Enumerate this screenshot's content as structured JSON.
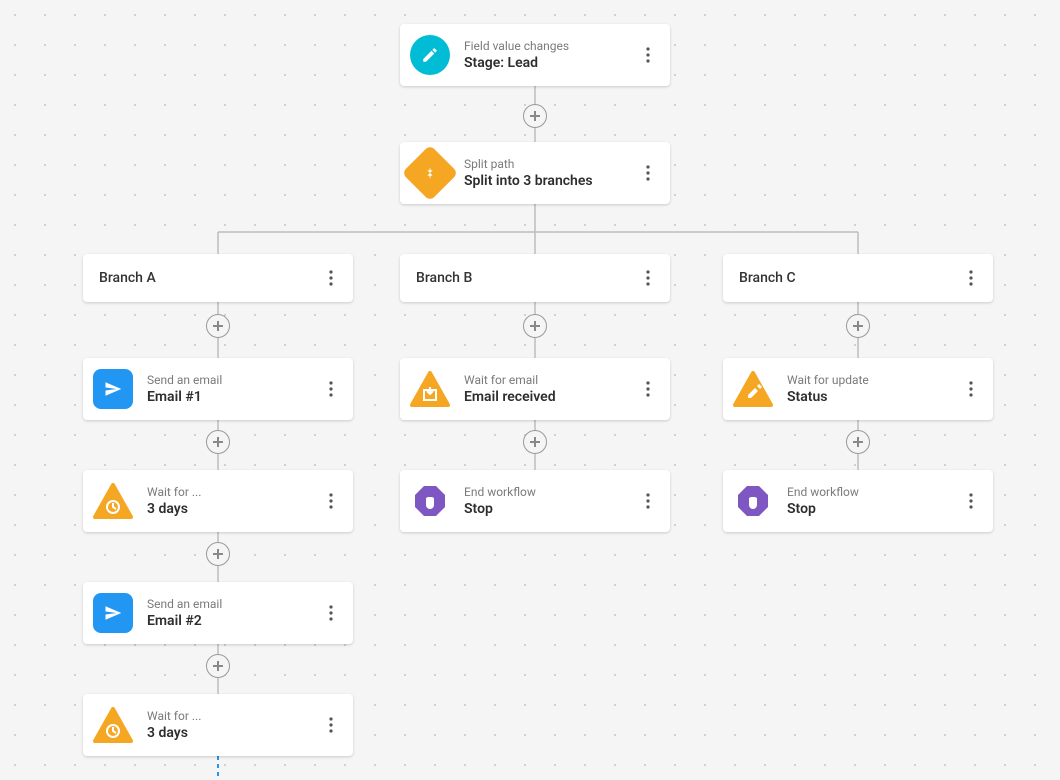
{
  "trigger": {
    "label": "Field value changes",
    "main": "Stage: Lead"
  },
  "split": {
    "label": "Split path",
    "main": "Split into 3 branches"
  },
  "branches": {
    "a": {
      "title": "Branch A"
    },
    "b": {
      "title": "Branch B"
    },
    "c": {
      "title": "Branch C"
    }
  },
  "a_email1": {
    "label": "Send an email",
    "main": "Email #1"
  },
  "a_wait1": {
    "label": "Wait for ...",
    "main": "3 days"
  },
  "a_email2": {
    "label": "Send an email",
    "main": "Email #2"
  },
  "a_wait2": {
    "label": "Wait for ...",
    "main": "3 days"
  },
  "b_wait": {
    "label": "Wait for email",
    "main": "Email received"
  },
  "b_end": {
    "label": "End workflow",
    "main": "Stop"
  },
  "c_wait": {
    "label": "Wait for update",
    "main": "Status"
  },
  "c_end": {
    "label": "End workflow",
    "main": "Stop"
  }
}
